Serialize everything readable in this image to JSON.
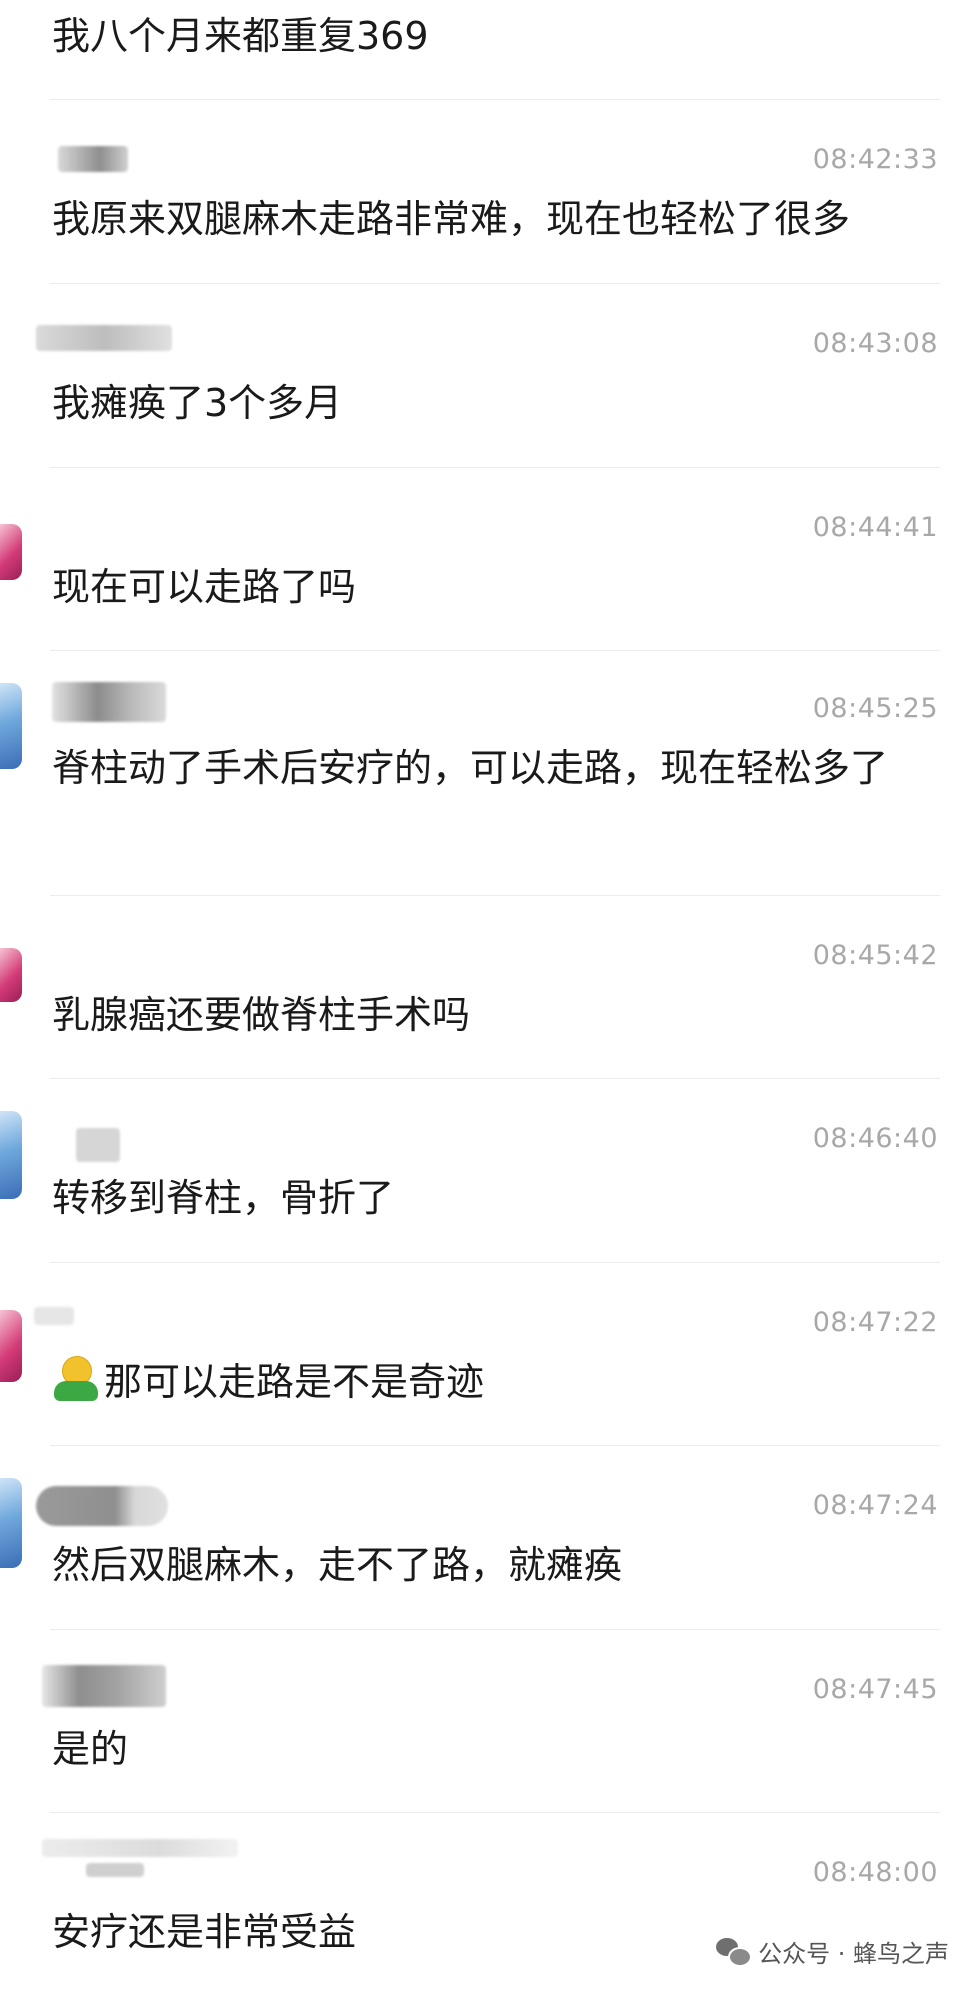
{
  "messages": [
    {
      "time": "",
      "text": "我八个月来都重复369"
    },
    {
      "time": "08:42:33",
      "text": "我原来双腿麻木走路非常难，现在也轻松了很多"
    },
    {
      "time": "08:43:08",
      "text": "我瘫痪了3个多月"
    },
    {
      "time": "08:44:41",
      "text": "现在可以走路了吗"
    },
    {
      "time": "08:45:25",
      "text": "脊柱动了手术后安疗的，可以走路，现在轻松多了"
    },
    {
      "time": "08:45:42",
      "text": "乳腺癌还要做脊柱手术吗"
    },
    {
      "time": "08:46:40",
      "text": "转移到脊柱，骨折了"
    },
    {
      "time": "08:47:22",
      "text": "那可以走路是不是奇迹"
    },
    {
      "time": "08:47:24",
      "text": "然后双腿麻木，走不了路，就瘫痪"
    },
    {
      "time": "08:47:45",
      "text": "是的"
    },
    {
      "time": "08:48:00",
      "text": "安疗还是非常受益"
    }
  ],
  "footer": {
    "brand": "公众号 · 蜂鸟之声",
    "icon": "wechat-icon"
  },
  "colors": {
    "time": "#a8a8a8",
    "text": "#1a1a1a",
    "divider": "#ececec"
  }
}
